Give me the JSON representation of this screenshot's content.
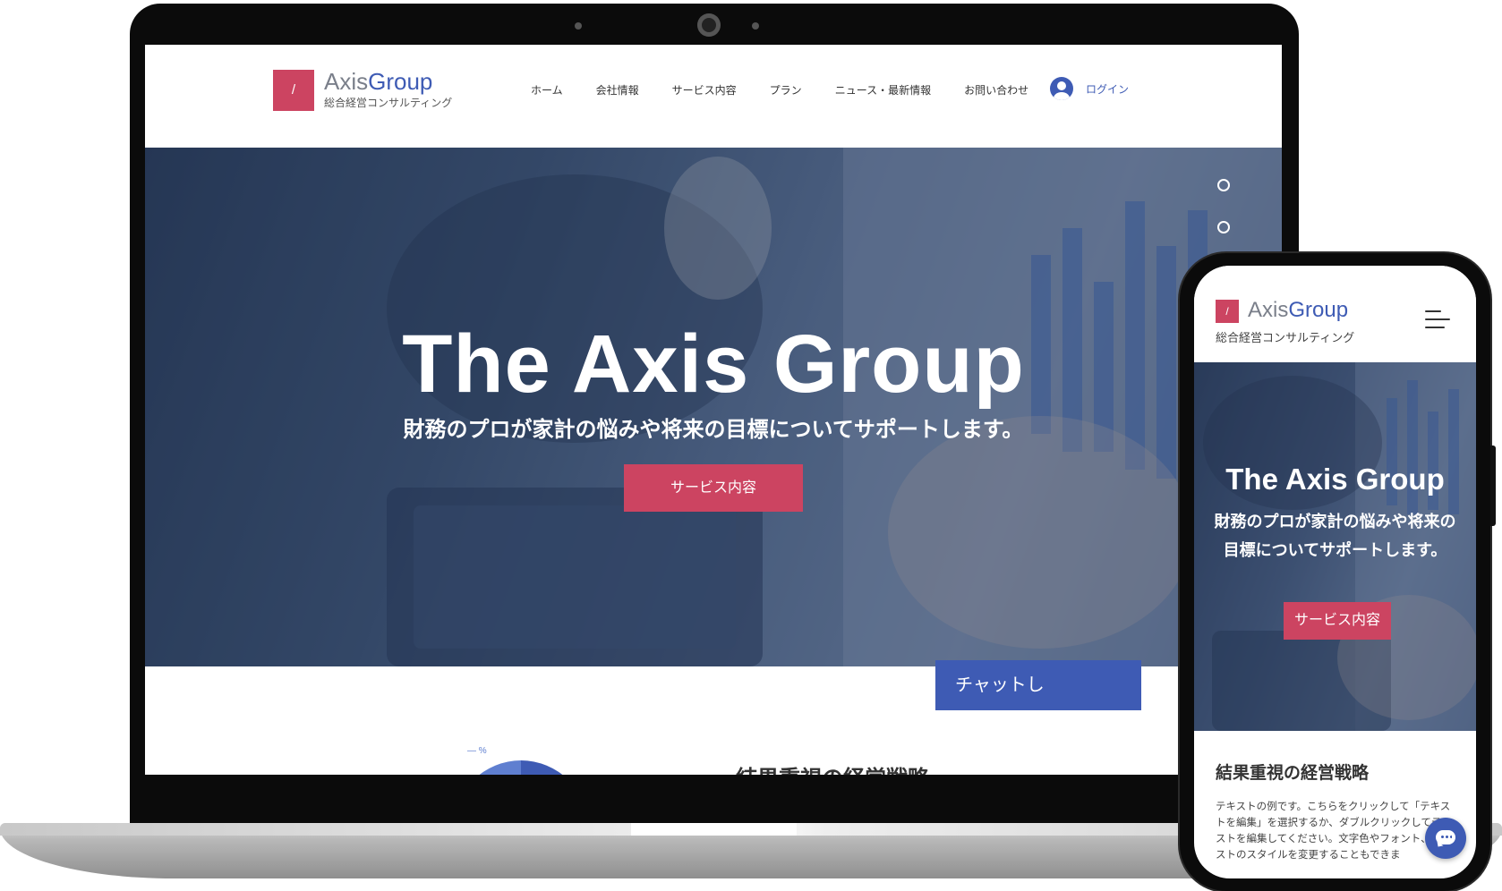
{
  "brand": {
    "logo_mark": "/",
    "name_part1": "Axis",
    "name_part2": "Group",
    "tagline": "総合経営コンサルティング",
    "accent_color": "#cc4461",
    "brand_blue": "#3e5bb4"
  },
  "nav": {
    "items": [
      "ホーム",
      "会社情報",
      "サービス内容",
      "プラン",
      "ニュース・最新情報",
      "お問い合わせ"
    ],
    "login_label": "ログイン",
    "login_icon": "user-avatar-icon"
  },
  "hero": {
    "title": "The Axis Group",
    "subtitle": "財務のプロが家計の悩みや将来の目標についてサポートします。",
    "button_label": "サービス内容",
    "slide_count": 2
  },
  "content": {
    "chat_button_label": "チャットし",
    "section_title": "結果重視の経営戦略",
    "pie_label": "%"
  },
  "mobile": {
    "hero_title": "The Axis Group",
    "hero_subtitle": "財務のプロが家計の悩みや将来の目標についてサポートします。",
    "hero_button_label": "サービス内容",
    "menu_icon": "hamburger-menu-icon",
    "section_title": "結果重視の経営戦略",
    "body_text": "テキストの例です。こちらをクリックして「テキストを編集」を選択するか、ダブルクリックしてテキストを編集してください。文字色やフォント、テキストのスタイルを変更することもできま",
    "chat_icon": "chat-bubble-icon"
  }
}
